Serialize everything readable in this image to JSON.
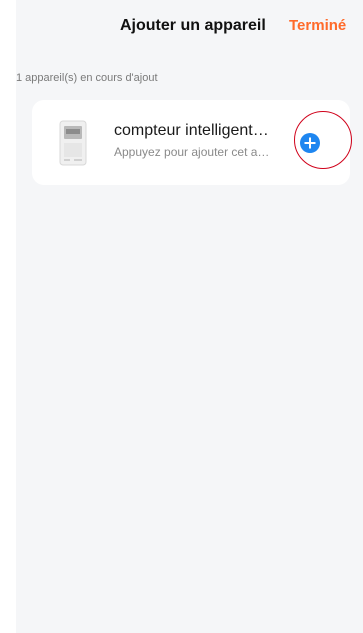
{
  "header": {
    "title": "Ajouter un appareil",
    "done_label": "Terminé"
  },
  "status": {
    "count_text": "1 appareil(s) en cours d'ajout"
  },
  "device": {
    "name": "compteur intelligent…",
    "subtitle": "Appuyez pour ajouter cet a…",
    "icon": "smart-meter-icon"
  },
  "colors": {
    "accent": "#ff6a2a",
    "add_button": "#1e86f0",
    "highlight_ring": "#d0021b",
    "background": "#f5f6f8"
  }
}
